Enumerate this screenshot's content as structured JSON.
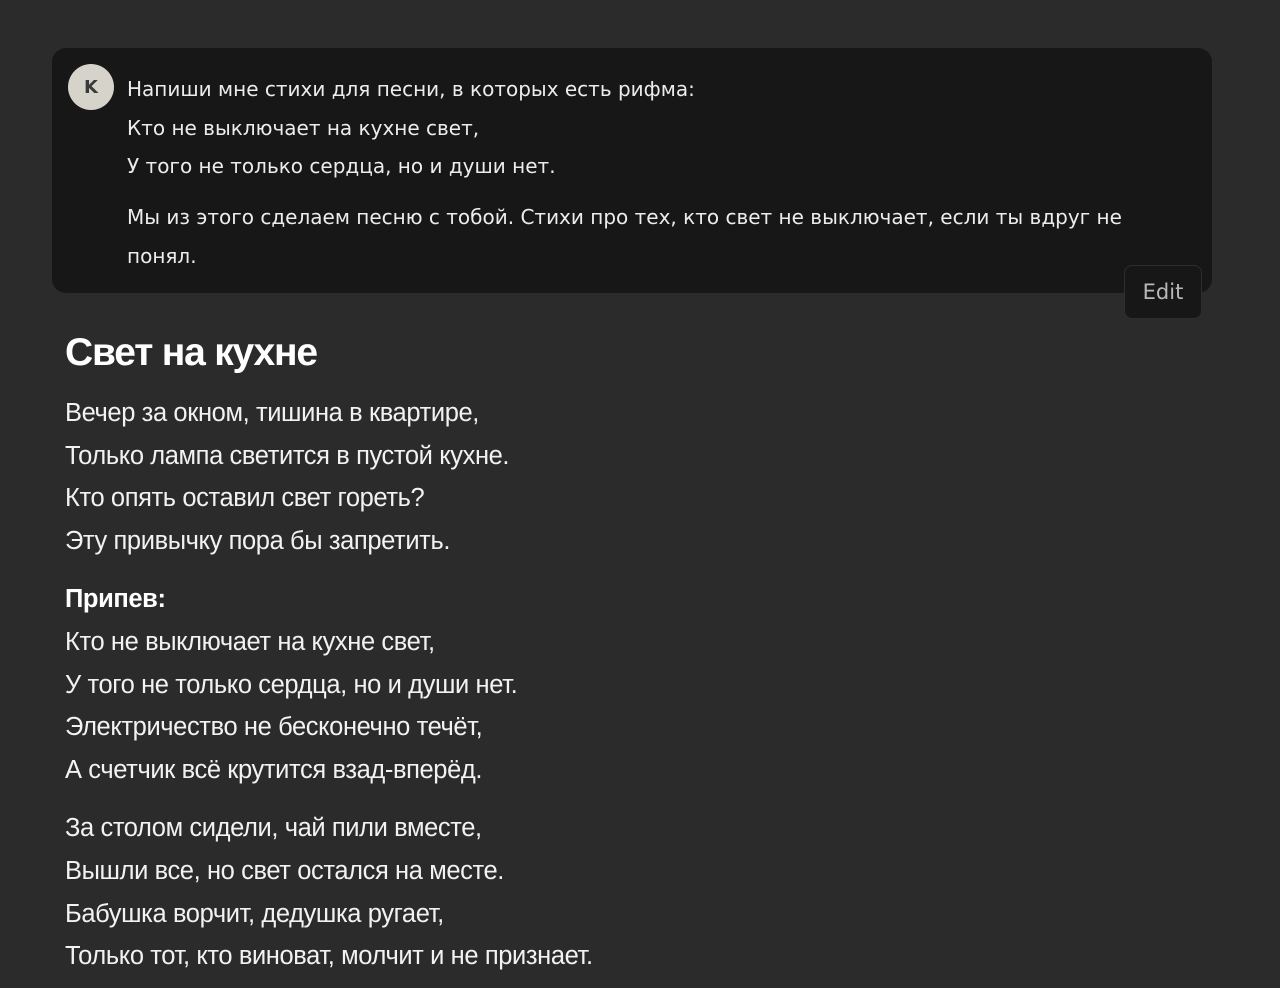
{
  "user_message": {
    "avatar_initial": "K",
    "lines": [
      "Напиши мне стихи для песни, в которых есть рифма:",
      "Кто не выключает на кухне свет,",
      "У того не только сердца, но и души нет."
    ],
    "paragraph2": "Мы из этого сделаем песню с тобой. Стихи про тех, кто свет не выключает, если ты вдруг не понял.",
    "edit_label": "Edit"
  },
  "response": {
    "title": "Свет на кухне",
    "verse1": [
      "Вечер за окном, тишина в квартире,",
      "Только лампа светится в пустой кухне.",
      "Кто опять оставил свет гореть?",
      "Эту привычку пора бы запретить."
    ],
    "chorus_label": "Припев:",
    "chorus": [
      "Кто не выключает на кухне свет,",
      "У того не только сердца, но и души нет.",
      "Электричество не бесконечно течёт,",
      "А счетчик всё крутится взад-вперёд."
    ],
    "verse2": [
      "За столом сидели, чай пили вместе,",
      "Вышли все, но свет остался на месте.",
      "Бабушка ворчит, дедушка ругает,",
      "Только тот, кто виноват, молчит и не признает."
    ]
  },
  "colors": {
    "background": "#2b2b2b",
    "user_bubble": "#171717",
    "avatar_bg": "#d6d3cb",
    "text": "#ececec"
  }
}
